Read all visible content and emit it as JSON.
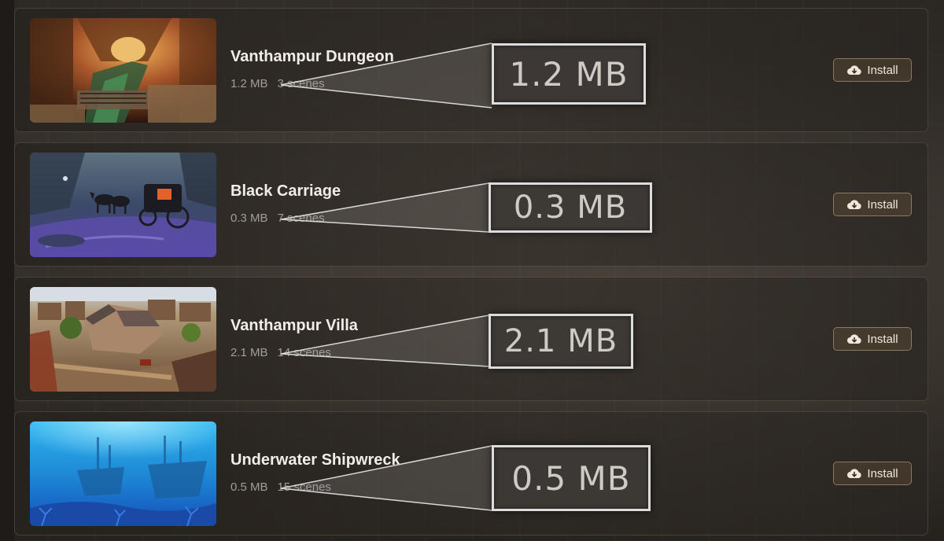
{
  "install_label": "Install",
  "install_icon": "cloud-download-icon",
  "scenarios": [
    {
      "title": "Vanthampur Dungeon",
      "size": "1.2 MB",
      "scenes": "3 scenes",
      "zoom_label": "1.2 MB",
      "thumbnail": "dungeon-sewer-image"
    },
    {
      "title": "Black Carriage",
      "size": "0.3 MB",
      "scenes": "7 scenes",
      "zoom_label": "0.3 MB",
      "thumbnail": "carriage-storm-image"
    },
    {
      "title": "Vanthampur Villa",
      "size": "2.1 MB",
      "scenes": "14 scenes",
      "zoom_label": "2.1 MB",
      "thumbnail": "villa-town-image"
    },
    {
      "title": "Underwater Shipwreck",
      "size": "0.5 MB",
      "scenes": "15 scenes",
      "zoom_label": "0.5 MB",
      "thumbnail": "shipwreck-underwater-image"
    }
  ]
}
